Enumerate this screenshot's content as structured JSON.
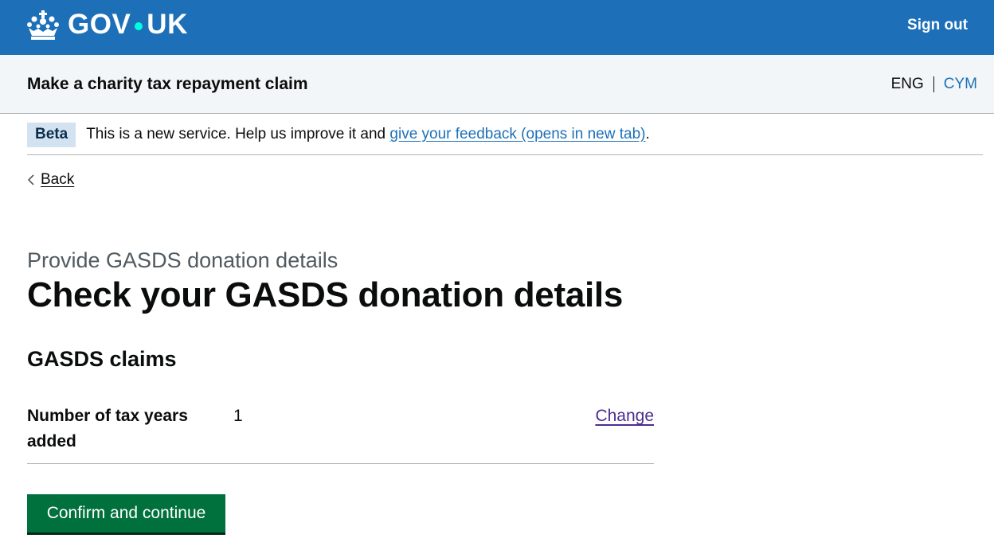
{
  "header": {
    "logo_text_left": "GOV",
    "logo_text_right": "UK",
    "crown_icon": "crown-icon",
    "sign_out": "Sign out"
  },
  "service": {
    "name": "Make a charity tax repayment claim",
    "lang_current": "ENG",
    "lang_other": "CYM"
  },
  "phase_banner": {
    "tag": "Beta",
    "text": "This is a new service. Help us improve it and",
    "link": "give your feedback (opens in new tab)",
    "after_link": "."
  },
  "back": {
    "label": "Back",
    "icon": "chevron-left-icon"
  },
  "main": {
    "caption": "Provide GASDS donation details",
    "title": "Check your GASDS donation details",
    "section_heading": "GASDS claims",
    "summary_rows": [
      {
        "key": "Number of tax years added",
        "value": "1",
        "action": "Change"
      }
    ],
    "primary_button": "Confirm and continue"
  },
  "colors": {
    "header_blue": "#1d70b8",
    "logo_dot": "#00ffe0",
    "service_bar": "#f3f6f8",
    "tag_bg": "#d2e2f1",
    "button_green": "#00703c",
    "visited_link": "#4c2c92"
  }
}
